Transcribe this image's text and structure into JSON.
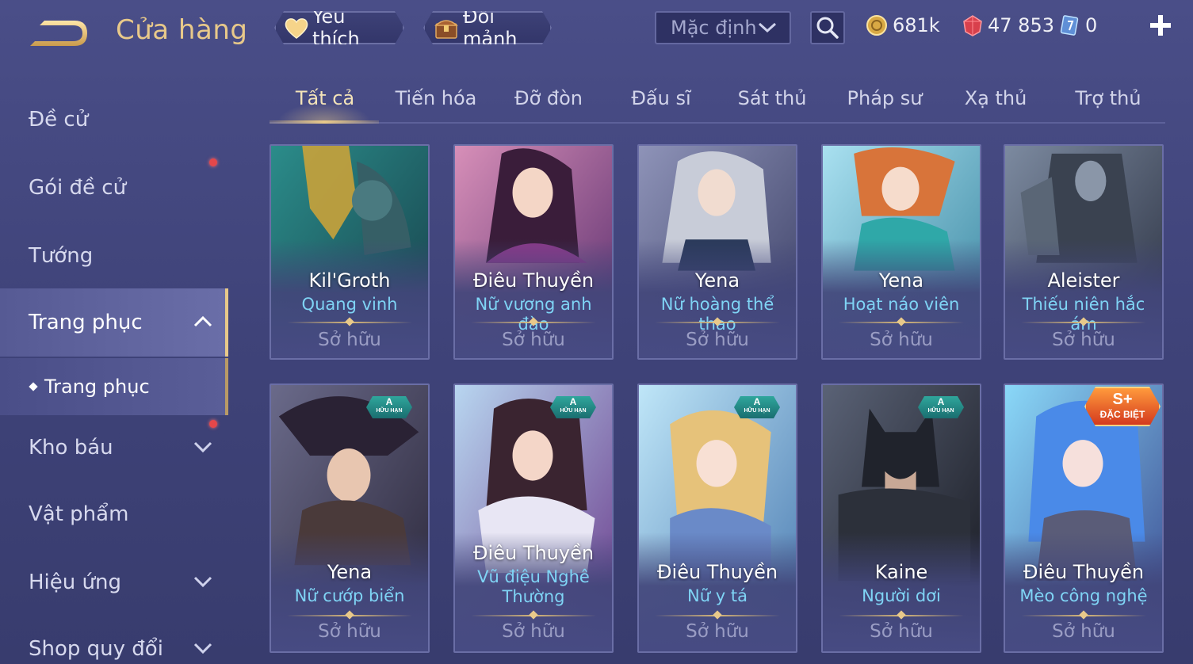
{
  "header": {
    "title": "Cửa hàng",
    "favorite_label": "Yêu thích",
    "shard_label": "Đổi mảnh",
    "sort_value": "Mặc định",
    "currencies": {
      "gold": "681k",
      "ruby": "47 853",
      "card": "0"
    }
  },
  "sidebar": {
    "items": [
      {
        "label": "Đề cử"
      },
      {
        "label": "Gói đề cử"
      },
      {
        "label": "Tướng"
      },
      {
        "label": "Trang phục"
      },
      {
        "label": "Kho báu"
      },
      {
        "label": "Vật phẩm"
      },
      {
        "label": "Hiệu ứng"
      },
      {
        "label": "Shop quy đổi"
      }
    ],
    "subitem": {
      "label": "Trang phục"
    }
  },
  "tabs": [
    "Tất cả",
    "Tiến hóa",
    "Đỡ đòn",
    "Đấu sĩ",
    "Sát thủ",
    "Pháp sư",
    "Xạ thủ",
    "Trợ thủ"
  ],
  "active_tab": "Tất cả",
  "cards": [
    {
      "hero": "Kil'Groth",
      "skin": "Quang vinh",
      "status": "Sở hữu",
      "badge": ""
    },
    {
      "hero": "Điêu Thuyền",
      "skin": "Nữ vương anh đào",
      "status": "Sở hữu",
      "badge": ""
    },
    {
      "hero": "Yena",
      "skin": "Nữ hoàng thể thao",
      "status": "Sở hữu",
      "badge": ""
    },
    {
      "hero": "Yena",
      "skin": "Hoạt náo viên",
      "status": "Sở hữu",
      "badge": ""
    },
    {
      "hero": "Aleister",
      "skin": "Thiếu niên hắc ám",
      "status": "Sở hữu",
      "badge": ""
    },
    {
      "hero": "Yena",
      "skin": "Nữ cướp biển",
      "status": "Sở hữu",
      "badge": "A",
      "badge_sub": "HỮU HẠN"
    },
    {
      "hero": "Điêu Thuyền",
      "skin": "Vũ điệu Nghê Thường",
      "status": "Sở hữu",
      "badge": "A",
      "badge_sub": "HỮU HẠN"
    },
    {
      "hero": "Điêu Thuyền",
      "skin": "Nữ y tá",
      "status": "Sở hữu",
      "badge": "A",
      "badge_sub": "HỮU HẠN"
    },
    {
      "hero": "Kaine",
      "skin": "Người dơi",
      "status": "Sở hữu",
      "badge": "A",
      "badge_sub": "HỮU HẠN"
    },
    {
      "hero": "Điêu Thuyền",
      "skin": "Mèo công nghệ",
      "status": "Sở hữu",
      "badge": "S+",
      "badge_sub": "ĐẶC BIỆT"
    }
  ],
  "colors": {
    "accent_gold": "#e8c98a",
    "skin_name": "#7fd4f5",
    "notification": "#e5474a"
  }
}
